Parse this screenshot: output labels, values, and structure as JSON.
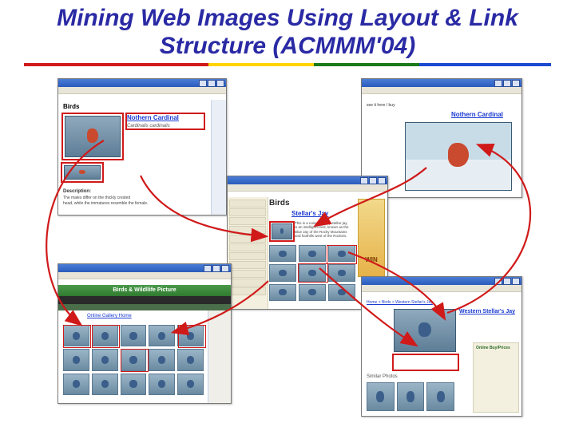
{
  "title": "Mining Web Images Using Layout & Link Structure (ACMMM'04)",
  "windows": {
    "w1": {
      "heading": "Birds",
      "link": "Nothern Cardinal",
      "sub": "Cardinalis cardinalis",
      "desc_label": "Description:",
      "desc_line1": "The males differ on the thickly crested",
      "desc_line2": "head, while the immatures resemble the female."
    },
    "w2": {
      "heading": "Nothern Cardinal",
      "sub": "see it here / buy"
    },
    "w3": {
      "brand": "Birds",
      "heading": "Stellar's Jay",
      "blurb": "This is a noisy, friendly stellar jay, is an intelligent bird, known as the Blue Jay of the Rocky Mountains and foothills west of the Rockies.",
      "ad": "WIN"
    },
    "w4": {
      "heading": "Birds & Wildllife Picture",
      "section": "Online Gallery Home"
    },
    "w5": {
      "nav": "Home > Birds > Western Stellar's Jay",
      "heading": "Western Stellar's Jay",
      "section": "Similar Photos",
      "sidebar": "Online Buy/Prices"
    }
  },
  "arrows": [
    {
      "from": "w1",
      "to": "w4"
    },
    {
      "from": "w1",
      "to": "w3"
    },
    {
      "from": "w2",
      "to": "w3"
    },
    {
      "from": "w3",
      "to": "w4"
    },
    {
      "from": "w3",
      "to": "w5"
    },
    {
      "from": "w3",
      "to": "w5"
    },
    {
      "from": "w5",
      "to": "w2"
    }
  ]
}
